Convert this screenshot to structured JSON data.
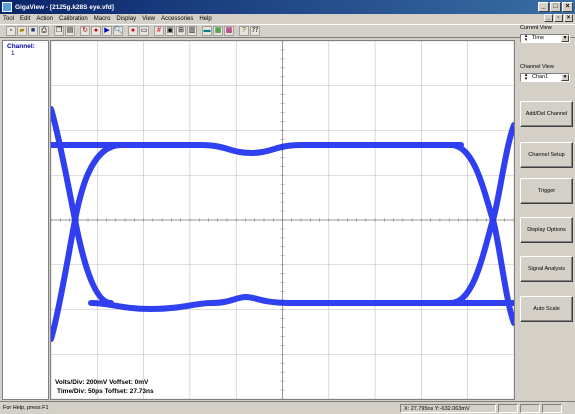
{
  "window": {
    "title": "GigaView - [2125g.k28S eye.vfd]"
  },
  "menu": {
    "items": [
      "Tool",
      "Edit",
      "Action",
      "Calibration",
      "Macro",
      "Display",
      "View",
      "Accessories",
      "Help"
    ]
  },
  "toolbar": {
    "icons": [
      "new-icon",
      "open-icon",
      "save-icon",
      "print-icon",
      "copy-icon",
      "paste-icon",
      "refresh-icon",
      "record-icon",
      "run-icon",
      "zoom-icon",
      "stop-icon",
      "ruler-icon",
      "grid-icon",
      "marker-icon",
      "measure-icon",
      "histogram-icon",
      "export-icon",
      "image-icon",
      "cursor-icon",
      "about-icon",
      "help-icon"
    ]
  },
  "channel_panel": {
    "label": "Channel:",
    "number": "1"
  },
  "readout": {
    "volts": "Volts/Div: 200mV Voffset: 0mV",
    "time": "Time/Div: 50ps Toffset: 27.73ns"
  },
  "right_panel": {
    "current_view_label": "Current View",
    "current_view_value": "Time",
    "channel_view_label": "Channel View",
    "channel_view_value": "Chan1",
    "buttons": [
      "Add/Del Channel",
      "Channel Setup",
      "Trigger",
      "Display Options",
      "Signal Analysis",
      "Auto Scale"
    ]
  },
  "status": {
    "help": "For Help, press F1",
    "coords": "X: 27.795ns Y:-632.063mV"
  },
  "colors": {
    "trace": "#1a2cf0",
    "grid": "#c0c0c0",
    "title_bg": "#0a246a"
  }
}
